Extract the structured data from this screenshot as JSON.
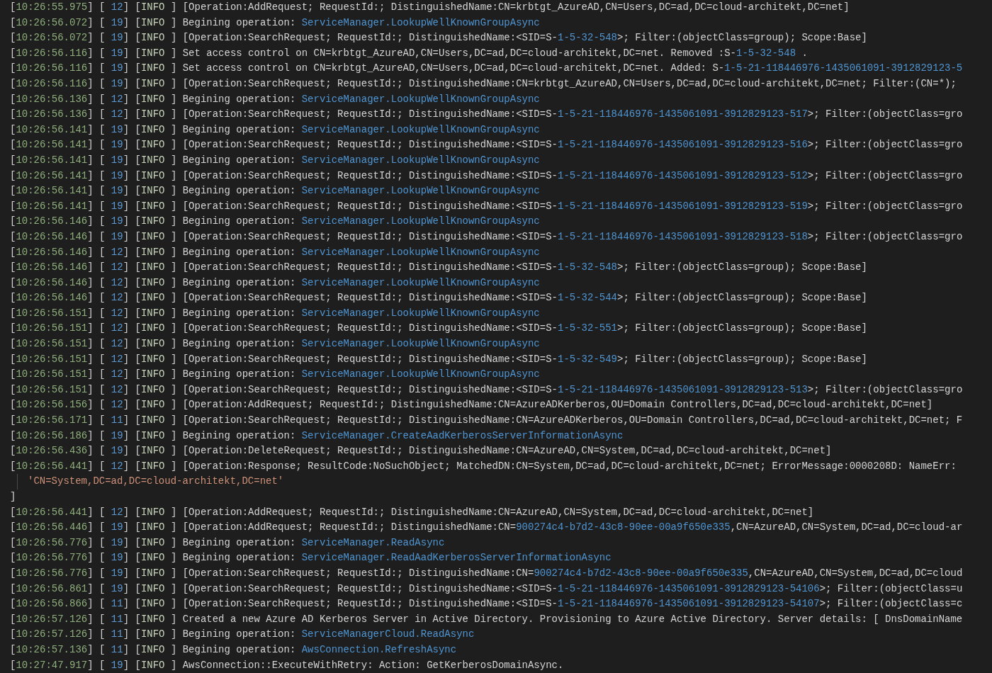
{
  "log": {
    "lines": [
      {
        "kind": "entry",
        "segments": [
          {
            "kind": "p",
            "text": "["
          },
          {
            "kind": "time",
            "text": "10:26:55.975"
          },
          {
            "kind": "p",
            "text": "] [ "
          },
          {
            "kind": "tid",
            "text": "12"
          },
          {
            "kind": "p",
            "text": "] ["
          },
          {
            "kind": "lvl",
            "text": "INFO"
          },
          {
            "kind": "p",
            "text": " ] [Operation:AddRequest; RequestId:; DistinguishedName:CN=krbtgt_AzureAD,CN=Users,DC=ad,DC=cloud-architekt,DC=net]"
          }
        ]
      },
      {
        "kind": "entry",
        "segments": [
          {
            "kind": "p",
            "text": "["
          },
          {
            "kind": "time",
            "text": "10:26:56.072"
          },
          {
            "kind": "p",
            "text": "] [ "
          },
          {
            "kind": "tid",
            "text": "19"
          },
          {
            "kind": "p",
            "text": "] ["
          },
          {
            "kind": "lvl",
            "text": "INFO"
          },
          {
            "kind": "p",
            "text": " ] Begining operation: "
          },
          {
            "kind": "hl",
            "text": "ServiceManager.LookupWellKnownGroupAsync"
          }
        ]
      },
      {
        "kind": "entry",
        "segments": [
          {
            "kind": "p",
            "text": "["
          },
          {
            "kind": "time",
            "text": "10:26:56.072"
          },
          {
            "kind": "p",
            "text": "] [ "
          },
          {
            "kind": "tid",
            "text": "19"
          },
          {
            "kind": "p",
            "text": "] ["
          },
          {
            "kind": "lvl",
            "text": "INFO"
          },
          {
            "kind": "p",
            "text": " ] [Operation:SearchRequest; RequestId:; DistinguishedName:<SID=S-"
          },
          {
            "kind": "hl",
            "text": "1-5-32-548"
          },
          {
            "kind": "p",
            "text": ">; Filter:(objectClass=group); Scope:Base]"
          }
        ]
      },
      {
        "kind": "entry",
        "segments": [
          {
            "kind": "p",
            "text": "["
          },
          {
            "kind": "time",
            "text": "10:26:56.116"
          },
          {
            "kind": "p",
            "text": "] [ "
          },
          {
            "kind": "tid",
            "text": "19"
          },
          {
            "kind": "p",
            "text": "] ["
          },
          {
            "kind": "lvl",
            "text": "INFO"
          },
          {
            "kind": "p",
            "text": " ] Set access control on CN=krbtgt_AzureAD,CN=Users,DC=ad,DC=cloud-architekt,DC=net. Removed :S-"
          },
          {
            "kind": "hl",
            "text": "1-5-32-548"
          },
          {
            "kind": "p",
            "text": " ."
          }
        ]
      },
      {
        "kind": "entry",
        "segments": [
          {
            "kind": "p",
            "text": "["
          },
          {
            "kind": "time",
            "text": "10:26:56.116"
          },
          {
            "kind": "p",
            "text": "] [ "
          },
          {
            "kind": "tid",
            "text": "19"
          },
          {
            "kind": "p",
            "text": "] ["
          },
          {
            "kind": "lvl",
            "text": "INFO"
          },
          {
            "kind": "p",
            "text": " ] Set access control on CN=krbtgt_AzureAD,CN=Users,DC=ad,DC=cloud-architekt,DC=net. Added: S-"
          },
          {
            "kind": "hl",
            "text": "1-5-21-118446976-1435061091-3912829123-5"
          }
        ]
      },
      {
        "kind": "entry",
        "segments": [
          {
            "kind": "p",
            "text": "["
          },
          {
            "kind": "time",
            "text": "10:26:56.116"
          },
          {
            "kind": "p",
            "text": "] [ "
          },
          {
            "kind": "tid",
            "text": "19"
          },
          {
            "kind": "p",
            "text": "] ["
          },
          {
            "kind": "lvl",
            "text": "INFO"
          },
          {
            "kind": "p",
            "text": " ] [Operation:SearchRequest; RequestId:; DistinguishedName:CN=krbtgt_AzureAD,CN=Users,DC=ad,DC=cloud-architekt,DC=net; Filter:(CN=*);"
          }
        ]
      },
      {
        "kind": "entry",
        "segments": [
          {
            "kind": "p",
            "text": "["
          },
          {
            "kind": "time",
            "text": "10:26:56.136"
          },
          {
            "kind": "p",
            "text": "] [ "
          },
          {
            "kind": "tid",
            "text": "12"
          },
          {
            "kind": "p",
            "text": "] ["
          },
          {
            "kind": "lvl",
            "text": "INFO"
          },
          {
            "kind": "p",
            "text": " ] Begining operation: "
          },
          {
            "kind": "hl",
            "text": "ServiceManager.LookupWellKnownGroupAsync"
          }
        ]
      },
      {
        "kind": "entry",
        "segments": [
          {
            "kind": "p",
            "text": "["
          },
          {
            "kind": "time",
            "text": "10:26:56.136"
          },
          {
            "kind": "p",
            "text": "] [ "
          },
          {
            "kind": "tid",
            "text": "12"
          },
          {
            "kind": "p",
            "text": "] ["
          },
          {
            "kind": "lvl",
            "text": "INFO"
          },
          {
            "kind": "p",
            "text": " ] [Operation:SearchRequest; RequestId:; DistinguishedName:<SID=S-"
          },
          {
            "kind": "hl",
            "text": "1-5-21-118446976-1435061091-3912829123-517"
          },
          {
            "kind": "p",
            "text": ">; Filter:(objectClass=gro"
          }
        ]
      },
      {
        "kind": "entry",
        "segments": [
          {
            "kind": "p",
            "text": "["
          },
          {
            "kind": "time",
            "text": "10:26:56.141"
          },
          {
            "kind": "p",
            "text": "] [ "
          },
          {
            "kind": "tid",
            "text": "19"
          },
          {
            "kind": "p",
            "text": "] ["
          },
          {
            "kind": "lvl",
            "text": "INFO"
          },
          {
            "kind": "p",
            "text": " ] Begining operation: "
          },
          {
            "kind": "hl",
            "text": "ServiceManager.LookupWellKnownGroupAsync"
          }
        ]
      },
      {
        "kind": "entry",
        "segments": [
          {
            "kind": "p",
            "text": "["
          },
          {
            "kind": "time",
            "text": "10:26:56.141"
          },
          {
            "kind": "p",
            "text": "] [ "
          },
          {
            "kind": "tid",
            "text": "19"
          },
          {
            "kind": "p",
            "text": "] ["
          },
          {
            "kind": "lvl",
            "text": "INFO"
          },
          {
            "kind": "p",
            "text": " ] [Operation:SearchRequest; RequestId:; DistinguishedName:<SID=S-"
          },
          {
            "kind": "hl",
            "text": "1-5-21-118446976-1435061091-3912829123-516"
          },
          {
            "kind": "p",
            "text": ">; Filter:(objectClass=gro"
          }
        ]
      },
      {
        "kind": "entry",
        "segments": [
          {
            "kind": "p",
            "text": "["
          },
          {
            "kind": "time",
            "text": "10:26:56.141"
          },
          {
            "kind": "p",
            "text": "] [ "
          },
          {
            "kind": "tid",
            "text": "19"
          },
          {
            "kind": "p",
            "text": "] ["
          },
          {
            "kind": "lvl",
            "text": "INFO"
          },
          {
            "kind": "p",
            "text": " ] Begining operation: "
          },
          {
            "kind": "hl",
            "text": "ServiceManager.LookupWellKnownGroupAsync"
          }
        ]
      },
      {
        "kind": "entry",
        "segments": [
          {
            "kind": "p",
            "text": "["
          },
          {
            "kind": "time",
            "text": "10:26:56.141"
          },
          {
            "kind": "p",
            "text": "] [ "
          },
          {
            "kind": "tid",
            "text": "19"
          },
          {
            "kind": "p",
            "text": "] ["
          },
          {
            "kind": "lvl",
            "text": "INFO"
          },
          {
            "kind": "p",
            "text": " ] [Operation:SearchRequest; RequestId:; DistinguishedName:<SID=S-"
          },
          {
            "kind": "hl",
            "text": "1-5-21-118446976-1435061091-3912829123-512"
          },
          {
            "kind": "p",
            "text": ">; Filter:(objectClass=gro"
          }
        ]
      },
      {
        "kind": "entry",
        "segments": [
          {
            "kind": "p",
            "text": "["
          },
          {
            "kind": "time",
            "text": "10:26:56.141"
          },
          {
            "kind": "p",
            "text": "] [ "
          },
          {
            "kind": "tid",
            "text": "19"
          },
          {
            "kind": "p",
            "text": "] ["
          },
          {
            "kind": "lvl",
            "text": "INFO"
          },
          {
            "kind": "p",
            "text": " ] Begining operation: "
          },
          {
            "kind": "hl",
            "text": "ServiceManager.LookupWellKnownGroupAsync"
          }
        ]
      },
      {
        "kind": "entry",
        "segments": [
          {
            "kind": "p",
            "text": "["
          },
          {
            "kind": "time",
            "text": "10:26:56.141"
          },
          {
            "kind": "p",
            "text": "] [ "
          },
          {
            "kind": "tid",
            "text": "19"
          },
          {
            "kind": "p",
            "text": "] ["
          },
          {
            "kind": "lvl",
            "text": "INFO"
          },
          {
            "kind": "p",
            "text": " ] [Operation:SearchRequest; RequestId:; DistinguishedName:<SID=S-"
          },
          {
            "kind": "hl",
            "text": "1-5-21-118446976-1435061091-3912829123-519"
          },
          {
            "kind": "p",
            "text": ">; Filter:(objectClass=gro"
          }
        ]
      },
      {
        "kind": "entry",
        "segments": [
          {
            "kind": "p",
            "text": "["
          },
          {
            "kind": "time",
            "text": "10:26:56.146"
          },
          {
            "kind": "p",
            "text": "] [ "
          },
          {
            "kind": "tid",
            "text": "19"
          },
          {
            "kind": "p",
            "text": "] ["
          },
          {
            "kind": "lvl",
            "text": "INFO"
          },
          {
            "kind": "p",
            "text": " ] Begining operation: "
          },
          {
            "kind": "hl",
            "text": "ServiceManager.LookupWellKnownGroupAsync"
          }
        ]
      },
      {
        "kind": "entry",
        "segments": [
          {
            "kind": "p",
            "text": "["
          },
          {
            "kind": "time",
            "text": "10:26:56.146"
          },
          {
            "kind": "p",
            "text": "] [ "
          },
          {
            "kind": "tid",
            "text": "19"
          },
          {
            "kind": "p",
            "text": "] ["
          },
          {
            "kind": "lvl",
            "text": "INFO"
          },
          {
            "kind": "p",
            "text": " ] [Operation:SearchRequest; RequestId:; DistinguishedName:<SID=S-"
          },
          {
            "kind": "hl",
            "text": "1-5-21-118446976-1435061091-3912829123-518"
          },
          {
            "kind": "p",
            "text": ">; Filter:(objectClass=gro"
          }
        ]
      },
      {
        "kind": "entry",
        "segments": [
          {
            "kind": "p",
            "text": "["
          },
          {
            "kind": "time",
            "text": "10:26:56.146"
          },
          {
            "kind": "p",
            "text": "] [ "
          },
          {
            "kind": "tid",
            "text": "12"
          },
          {
            "kind": "p",
            "text": "] ["
          },
          {
            "kind": "lvl",
            "text": "INFO"
          },
          {
            "kind": "p",
            "text": " ] Begining operation: "
          },
          {
            "kind": "hl",
            "text": "ServiceManager.LookupWellKnownGroupAsync"
          }
        ]
      },
      {
        "kind": "entry",
        "segments": [
          {
            "kind": "p",
            "text": "["
          },
          {
            "kind": "time",
            "text": "10:26:56.146"
          },
          {
            "kind": "p",
            "text": "] [ "
          },
          {
            "kind": "tid",
            "text": "12"
          },
          {
            "kind": "p",
            "text": "] ["
          },
          {
            "kind": "lvl",
            "text": "INFO"
          },
          {
            "kind": "p",
            "text": " ] [Operation:SearchRequest; RequestId:; DistinguishedName:<SID=S-"
          },
          {
            "kind": "hl",
            "text": "1-5-32-548"
          },
          {
            "kind": "p",
            "text": ">; Filter:(objectClass=group); Scope:Base]"
          }
        ]
      },
      {
        "kind": "entry",
        "segments": [
          {
            "kind": "p",
            "text": "["
          },
          {
            "kind": "time",
            "text": "10:26:56.146"
          },
          {
            "kind": "p",
            "text": "] [ "
          },
          {
            "kind": "tid",
            "text": "12"
          },
          {
            "kind": "p",
            "text": "] ["
          },
          {
            "kind": "lvl",
            "text": "INFO"
          },
          {
            "kind": "p",
            "text": " ] Begining operation: "
          },
          {
            "kind": "hl",
            "text": "ServiceManager.LookupWellKnownGroupAsync"
          }
        ]
      },
      {
        "kind": "entry",
        "segments": [
          {
            "kind": "p",
            "text": "["
          },
          {
            "kind": "time",
            "text": "10:26:56.146"
          },
          {
            "kind": "p",
            "text": "] [ "
          },
          {
            "kind": "tid",
            "text": "12"
          },
          {
            "kind": "p",
            "text": "] ["
          },
          {
            "kind": "lvl",
            "text": "INFO"
          },
          {
            "kind": "p",
            "text": " ] [Operation:SearchRequest; RequestId:; DistinguishedName:<SID=S-"
          },
          {
            "kind": "hl",
            "text": "1-5-32-544"
          },
          {
            "kind": "p",
            "text": ">; Filter:(objectClass=group); Scope:Base]"
          }
        ]
      },
      {
        "kind": "entry",
        "segments": [
          {
            "kind": "p",
            "text": "["
          },
          {
            "kind": "time",
            "text": "10:26:56.151"
          },
          {
            "kind": "p",
            "text": "] [ "
          },
          {
            "kind": "tid",
            "text": "12"
          },
          {
            "kind": "p",
            "text": "] ["
          },
          {
            "kind": "lvl",
            "text": "INFO"
          },
          {
            "kind": "p",
            "text": " ] Begining operation: "
          },
          {
            "kind": "hl",
            "text": "ServiceManager.LookupWellKnownGroupAsync"
          }
        ]
      },
      {
        "kind": "entry",
        "segments": [
          {
            "kind": "p",
            "text": "["
          },
          {
            "kind": "time",
            "text": "10:26:56.151"
          },
          {
            "kind": "p",
            "text": "] [ "
          },
          {
            "kind": "tid",
            "text": "12"
          },
          {
            "kind": "p",
            "text": "] ["
          },
          {
            "kind": "lvl",
            "text": "INFO"
          },
          {
            "kind": "p",
            "text": " ] [Operation:SearchRequest; RequestId:; DistinguishedName:<SID=S-"
          },
          {
            "kind": "hl",
            "text": "1-5-32-551"
          },
          {
            "kind": "p",
            "text": ">; Filter:(objectClass=group); Scope:Base]"
          }
        ]
      },
      {
        "kind": "entry",
        "segments": [
          {
            "kind": "p",
            "text": "["
          },
          {
            "kind": "time",
            "text": "10:26:56.151"
          },
          {
            "kind": "p",
            "text": "] [ "
          },
          {
            "kind": "tid",
            "text": "12"
          },
          {
            "kind": "p",
            "text": "] ["
          },
          {
            "kind": "lvl",
            "text": "INFO"
          },
          {
            "kind": "p",
            "text": " ] Begining operation: "
          },
          {
            "kind": "hl",
            "text": "ServiceManager.LookupWellKnownGroupAsync"
          }
        ]
      },
      {
        "kind": "entry",
        "segments": [
          {
            "kind": "p",
            "text": "["
          },
          {
            "kind": "time",
            "text": "10:26:56.151"
          },
          {
            "kind": "p",
            "text": "] [ "
          },
          {
            "kind": "tid",
            "text": "12"
          },
          {
            "kind": "p",
            "text": "] ["
          },
          {
            "kind": "lvl",
            "text": "INFO"
          },
          {
            "kind": "p",
            "text": " ] [Operation:SearchRequest; RequestId:; DistinguishedName:<SID=S-"
          },
          {
            "kind": "hl",
            "text": "1-5-32-549"
          },
          {
            "kind": "p",
            "text": ">; Filter:(objectClass=group); Scope:Base]"
          }
        ]
      },
      {
        "kind": "entry",
        "segments": [
          {
            "kind": "p",
            "text": "["
          },
          {
            "kind": "time",
            "text": "10:26:56.151"
          },
          {
            "kind": "p",
            "text": "] [ "
          },
          {
            "kind": "tid",
            "text": "12"
          },
          {
            "kind": "p",
            "text": "] ["
          },
          {
            "kind": "lvl",
            "text": "INFO"
          },
          {
            "kind": "p",
            "text": " ] Begining operation: "
          },
          {
            "kind": "hl",
            "text": "ServiceManager.LookupWellKnownGroupAsync"
          }
        ]
      },
      {
        "kind": "entry",
        "segments": [
          {
            "kind": "p",
            "text": "["
          },
          {
            "kind": "time",
            "text": "10:26:56.151"
          },
          {
            "kind": "p",
            "text": "] [ "
          },
          {
            "kind": "tid",
            "text": "12"
          },
          {
            "kind": "p",
            "text": "] ["
          },
          {
            "kind": "lvl",
            "text": "INFO"
          },
          {
            "kind": "p",
            "text": " ] [Operation:SearchRequest; RequestId:; DistinguishedName:<SID=S-"
          },
          {
            "kind": "hl",
            "text": "1-5-21-118446976-1435061091-3912829123-513"
          },
          {
            "kind": "p",
            "text": ">; Filter:(objectClass=gro"
          }
        ]
      },
      {
        "kind": "entry",
        "segments": [
          {
            "kind": "p",
            "text": "["
          },
          {
            "kind": "time",
            "text": "10:26:56.156"
          },
          {
            "kind": "p",
            "text": "] [ "
          },
          {
            "kind": "tid",
            "text": "12"
          },
          {
            "kind": "p",
            "text": "] ["
          },
          {
            "kind": "lvl",
            "text": "INFO"
          },
          {
            "kind": "p",
            "text": " ] [Operation:AddRequest; RequestId:; DistinguishedName:CN=AzureADKerberos,OU=Domain Controllers,DC=ad,DC=cloud-architekt,DC=net]"
          }
        ]
      },
      {
        "kind": "entry",
        "segments": [
          {
            "kind": "p",
            "text": "["
          },
          {
            "kind": "time",
            "text": "10:26:56.171"
          },
          {
            "kind": "p",
            "text": "] [ "
          },
          {
            "kind": "tid",
            "text": "11"
          },
          {
            "kind": "p",
            "text": "] ["
          },
          {
            "kind": "lvl",
            "text": "INFO"
          },
          {
            "kind": "p",
            "text": " ] [Operation:SearchRequest; RequestId:; DistinguishedName:CN=AzureADKerberos,OU=Domain Controllers,DC=ad,DC=cloud-architekt,DC=net; F"
          }
        ]
      },
      {
        "kind": "entry",
        "segments": [
          {
            "kind": "p",
            "text": "["
          },
          {
            "kind": "time",
            "text": "10:26:56.186"
          },
          {
            "kind": "p",
            "text": "] [ "
          },
          {
            "kind": "tid",
            "text": "19"
          },
          {
            "kind": "p",
            "text": "] ["
          },
          {
            "kind": "lvl",
            "text": "INFO"
          },
          {
            "kind": "p",
            "text": " ] Begining operation: "
          },
          {
            "kind": "hl",
            "text": "ServiceManager.CreateAadKerberosServerInformationAsync"
          }
        ]
      },
      {
        "kind": "entry",
        "segments": [
          {
            "kind": "p",
            "text": "["
          },
          {
            "kind": "time",
            "text": "10:26:56.436"
          },
          {
            "kind": "p",
            "text": "] [ "
          },
          {
            "kind": "tid",
            "text": "19"
          },
          {
            "kind": "p",
            "text": "] ["
          },
          {
            "kind": "lvl",
            "text": "INFO"
          },
          {
            "kind": "p",
            "text": " ] [Operation:DeleteRequest; RequestId:; DistinguishedName:CN=AzureAD,CN=System,DC=ad,DC=cloud-architekt,DC=net]"
          }
        ]
      },
      {
        "kind": "entry",
        "segments": [
          {
            "kind": "p",
            "text": "["
          },
          {
            "kind": "time",
            "text": "10:26:56.441"
          },
          {
            "kind": "p",
            "text": "] [ "
          },
          {
            "kind": "tid",
            "text": "12"
          },
          {
            "kind": "p",
            "text": "] ["
          },
          {
            "kind": "lvl",
            "text": "INFO"
          },
          {
            "kind": "p",
            "text": " ] [Operation:Response; ResultCode:NoSuchObject; MatchedDN:CN=System,DC=ad,DC=cloud-architekt,DC=net; ErrorMessage:0000208D: NameErr:"
          }
        ]
      },
      {
        "kind": "continuation",
        "segments": [
          {
            "kind": "str",
            "text": "'CN=System,DC=ad,DC=cloud-architekt,DC=net'"
          }
        ]
      },
      {
        "kind": "entry",
        "segments": [
          {
            "kind": "p",
            "text": "]"
          }
        ]
      },
      {
        "kind": "entry",
        "segments": [
          {
            "kind": "p",
            "text": "["
          },
          {
            "kind": "time",
            "text": "10:26:56.441"
          },
          {
            "kind": "p",
            "text": "] [ "
          },
          {
            "kind": "tid",
            "text": "12"
          },
          {
            "kind": "p",
            "text": "] ["
          },
          {
            "kind": "lvl",
            "text": "INFO"
          },
          {
            "kind": "p",
            "text": " ] [Operation:AddRequest; RequestId:; DistinguishedName:CN=AzureAD,CN=System,DC=ad,DC=cloud-architekt,DC=net]"
          }
        ]
      },
      {
        "kind": "entry",
        "segments": [
          {
            "kind": "p",
            "text": "["
          },
          {
            "kind": "time",
            "text": "10:26:56.446"
          },
          {
            "kind": "p",
            "text": "] [ "
          },
          {
            "kind": "tid",
            "text": "19"
          },
          {
            "kind": "p",
            "text": "] ["
          },
          {
            "kind": "lvl",
            "text": "INFO"
          },
          {
            "kind": "p",
            "text": " ] [Operation:AddRequest; RequestId:; DistinguishedName:CN="
          },
          {
            "kind": "hl",
            "text": "900274c4-b7d2-43c8-90ee-00a9f650e335"
          },
          {
            "kind": "p",
            "text": ",CN=AzureAD,CN=System,DC=ad,DC=cloud-ar"
          }
        ]
      },
      {
        "kind": "entry",
        "segments": [
          {
            "kind": "p",
            "text": "["
          },
          {
            "kind": "time",
            "text": "10:26:56.776"
          },
          {
            "kind": "p",
            "text": "] [ "
          },
          {
            "kind": "tid",
            "text": "19"
          },
          {
            "kind": "p",
            "text": "] ["
          },
          {
            "kind": "lvl",
            "text": "INFO"
          },
          {
            "kind": "p",
            "text": " ] Begining operation: "
          },
          {
            "kind": "hl",
            "text": "ServiceManager.ReadAsync"
          }
        ]
      },
      {
        "kind": "entry",
        "segments": [
          {
            "kind": "p",
            "text": "["
          },
          {
            "kind": "time",
            "text": "10:26:56.776"
          },
          {
            "kind": "p",
            "text": "] [ "
          },
          {
            "kind": "tid",
            "text": "19"
          },
          {
            "kind": "p",
            "text": "] ["
          },
          {
            "kind": "lvl",
            "text": "INFO"
          },
          {
            "kind": "p",
            "text": " ] Begining operation: "
          },
          {
            "kind": "hl",
            "text": "ServiceManager.ReadAadKerberosServerInformationAsync"
          }
        ]
      },
      {
        "kind": "entry",
        "segments": [
          {
            "kind": "p",
            "text": "["
          },
          {
            "kind": "time",
            "text": "10:26:56.776"
          },
          {
            "kind": "p",
            "text": "] [ "
          },
          {
            "kind": "tid",
            "text": "19"
          },
          {
            "kind": "p",
            "text": "] ["
          },
          {
            "kind": "lvl",
            "text": "INFO"
          },
          {
            "kind": "p",
            "text": " ] [Operation:SearchRequest; RequestId:; DistinguishedName:CN="
          },
          {
            "kind": "hl",
            "text": "900274c4-b7d2-43c8-90ee-00a9f650e335"
          },
          {
            "kind": "p",
            "text": ",CN=AzureAD,CN=System,DC=ad,DC=cloud"
          }
        ]
      },
      {
        "kind": "entry",
        "segments": [
          {
            "kind": "p",
            "text": "["
          },
          {
            "kind": "time",
            "text": "10:26:56.861"
          },
          {
            "kind": "p",
            "text": "] [ "
          },
          {
            "kind": "tid",
            "text": "19"
          },
          {
            "kind": "p",
            "text": "] ["
          },
          {
            "kind": "lvl",
            "text": "INFO"
          },
          {
            "kind": "p",
            "text": " ] [Operation:SearchRequest; RequestId:; DistinguishedName:<SID=S-"
          },
          {
            "kind": "hl",
            "text": "1-5-21-118446976-1435061091-3912829123-54106"
          },
          {
            "kind": "p",
            "text": ">; Filter:(objectClass=u"
          }
        ]
      },
      {
        "kind": "entry",
        "segments": [
          {
            "kind": "p",
            "text": "["
          },
          {
            "kind": "time",
            "text": "10:26:56.866"
          },
          {
            "kind": "p",
            "text": "] [ "
          },
          {
            "kind": "tid",
            "text": "11"
          },
          {
            "kind": "p",
            "text": "] ["
          },
          {
            "kind": "lvl",
            "text": "INFO"
          },
          {
            "kind": "p",
            "text": " ] [Operation:SearchRequest; RequestId:; DistinguishedName:<SID=S-"
          },
          {
            "kind": "hl",
            "text": "1-5-21-118446976-1435061091-3912829123-54107"
          },
          {
            "kind": "p",
            "text": ">; Filter:(objectClass=c"
          }
        ]
      },
      {
        "kind": "entry",
        "segments": [
          {
            "kind": "p",
            "text": "["
          },
          {
            "kind": "time",
            "text": "10:26:57.126"
          },
          {
            "kind": "p",
            "text": "] [ "
          },
          {
            "kind": "tid",
            "text": "11"
          },
          {
            "kind": "p",
            "text": "] ["
          },
          {
            "kind": "lvl",
            "text": "INFO"
          },
          {
            "kind": "p",
            "text": " ] Created a new Azure AD Kerberos Server in Active Directory. Provisioning to Azure Active Directory. Server details: [ DnsDomainName"
          }
        ]
      },
      {
        "kind": "entry",
        "segments": [
          {
            "kind": "p",
            "text": "["
          },
          {
            "kind": "time",
            "text": "10:26:57.126"
          },
          {
            "kind": "p",
            "text": "] [ "
          },
          {
            "kind": "tid",
            "text": "11"
          },
          {
            "kind": "p",
            "text": "] ["
          },
          {
            "kind": "lvl",
            "text": "INFO"
          },
          {
            "kind": "p",
            "text": " ] Begining operation: "
          },
          {
            "kind": "hl",
            "text": "ServiceManagerCloud.ReadAsync"
          }
        ]
      },
      {
        "kind": "entry",
        "segments": [
          {
            "kind": "p",
            "text": "["
          },
          {
            "kind": "time",
            "text": "10:26:57.136"
          },
          {
            "kind": "p",
            "text": "] [ "
          },
          {
            "kind": "tid",
            "text": "11"
          },
          {
            "kind": "p",
            "text": "] ["
          },
          {
            "kind": "lvl",
            "text": "INFO"
          },
          {
            "kind": "p",
            "text": " ] Begining operation: "
          },
          {
            "kind": "hl",
            "text": "AwsConnection.RefreshAsync"
          }
        ]
      },
      {
        "kind": "entry",
        "segments": [
          {
            "kind": "p",
            "text": "["
          },
          {
            "kind": "time",
            "text": "10:27:47.917"
          },
          {
            "kind": "p",
            "text": "] [ "
          },
          {
            "kind": "tid",
            "text": "19"
          },
          {
            "kind": "p",
            "text": "] ["
          },
          {
            "kind": "lvl",
            "text": "INFO"
          },
          {
            "kind": "p",
            "text": " ] AwsConnection::ExecuteWithRetry: Action: GetKerberosDomainAsync."
          }
        ]
      }
    ]
  }
}
